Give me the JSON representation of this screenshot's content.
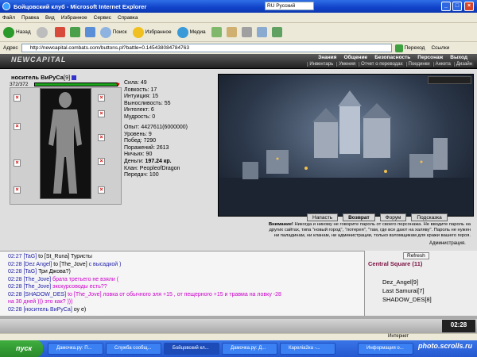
{
  "window": {
    "title": "Бойцовский клуб - Microsoft Internet Explorer",
    "language": "RU Русский"
  },
  "menu": [
    "Файл",
    "Правка",
    "Вид",
    "Избранное",
    "Сервис",
    "Справка"
  ],
  "toolbar": {
    "back": "Назад",
    "search": "Поиск",
    "favorites": "Избранное",
    "media": "Медиа"
  },
  "address": {
    "label": "Адрес",
    "url": "http://newcapital.combats.com/buttons.pl?battle=0.145438084784763",
    "go": "Переход",
    "links": "Ссылки"
  },
  "site": {
    "logo": "NEWCAPITAL",
    "nav_top": [
      "Знания",
      "Общение",
      "Безопасность",
      "Персонаж",
      "Выход"
    ],
    "nav_bottom": [
      "Инвентарь",
      "Умения",
      "Отчет о переводах",
      "Поединки",
      "Анкета",
      "Дизайн"
    ]
  },
  "character": {
    "name": "носитель ВиРуСа",
    "level": "[9]",
    "hp": "372/372",
    "hp_fraction": 1.0,
    "stats": [
      "Сила: 49",
      "Ловкость: 17",
      "Интуиция: 15",
      "Выносливость: 55",
      "Интелект: 6",
      "Мудрость: 0"
    ],
    "info": [
      "Опыт: 4427611(6000000)",
      "Уровень: 9",
      "Побед: 7290",
      "Поражений: 2613",
      "Ничьих: 90"
    ],
    "money_label": "Деньги:",
    "money_value": "197.24 кр.",
    "clan": "Клан: PeopleofDragon",
    "transfers": "Передач: 100"
  },
  "scene_buttons": [
    "Напасть",
    "Возврат",
    "Форум",
    "Подсказка"
  ],
  "warning": {
    "bold": "Внимание!",
    "text1": " Никогда и никому не говорите пароль от своего персонажа. Не вводите пароль на",
    "text2": "других сайтах, типа \"новый город\", \"лотерея\", \"там, где все дают на халяву\". Пароль не нужен",
    "text3": "ни паладинам, ни кланам, ни администрации, только взломщикам для кражи вашего героя.",
    "admin": "Администрация."
  },
  "chat": [
    {
      "time": "02:27",
      "parts": [
        {
          "c": "n",
          "t": "[TaG]"
        },
        {
          "c": "t",
          "t": " to [St_Runa] Туристы "
        }
      ]
    },
    {
      "time": "02:28",
      "parts": [
        {
          "c": "n",
          "t": "[Dez Angel]"
        },
        {
          "c": "t",
          "t": " to [The_Jove] "
        },
        {
          "c": "n",
          "t": "с высадкой )"
        }
      ]
    },
    {
      "time": "02:28",
      "parts": [
        {
          "c": "n",
          "t": "[TaG]"
        },
        {
          "c": "t",
          "t": " Три Джова?)"
        }
      ]
    },
    {
      "time": "02:28",
      "parts": [
        {
          "c": "n",
          "t": "[The_Jove]"
        },
        {
          "c": "m",
          "t": " брата третьего не взяли ("
        }
      ]
    },
    {
      "time": "02:28",
      "parts": [
        {
          "c": "n",
          "t": "[The_Jove]"
        },
        {
          "c": "m",
          "t": " экскурсоводы есть??"
        }
      ]
    },
    {
      "time": "02:28",
      "parts": [
        {
          "c": "n",
          "t": "[SHADOW_DES]"
        },
        {
          "c": "m",
          "t": " to [The_Jove] ловка от обычного эля +15 , от пещерного +15 и травма на ловку -28"
        }
      ]
    },
    {
      "time": "",
      "parts": [
        {
          "c": "m",
          "t": "на 30 дней ))) это как? )))"
        }
      ]
    },
    {
      "time": "02:28",
      "parts": [
        {
          "c": "n",
          "t": "[носитель ВиРуСа]"
        },
        {
          "c": "t",
          "t": " оу е)"
        }
      ]
    }
  ],
  "online": {
    "refresh": "Refresh",
    "room": "Central Square (11)",
    "users": [
      "Dez_Angel[9]",
      "Last Samurai[7]",
      "SHADOW_DES[8]"
    ]
  },
  "clock": "02:28",
  "status": {
    "done": "",
    "zone": "Интернет"
  },
  "taskbar": {
    "start": "пуск",
    "tasks": [
      "Дамочка.ру: П...",
      "Служба сообщ...",
      "Бойцовский кл...",
      "Дамочка.ру: Д...",
      "Карелia2ка -...",
      "Информация о..."
    ],
    "watermark": "photo.scrolls.ru"
  }
}
